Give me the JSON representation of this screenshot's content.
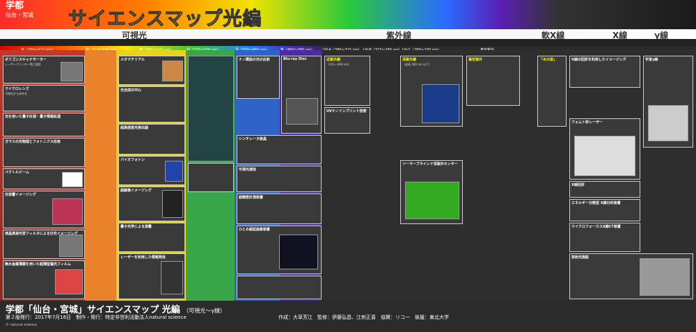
{
  "header": {
    "logo_top": "学都",
    "logo_sub": "仙台・宮城",
    "title": "サイエンスマップ",
    "title_suffix": "光編"
  },
  "bands": [
    "可視光",
    "紫外線",
    "軟X線",
    "X線",
    "γ線"
  ],
  "subbands": [
    "赤（760〜610 nm）",
    "橙（610〜590 nm）",
    "黄（590〜570 nm）",
    "緑（570〜500 nm）",
    "青（500〜460 nm）",
    "紫（460〜380 nm）",
    "UV-A（380〜315 nm）",
    "UV-B（315〜280 nm）",
    "UV-C（280〜100 nm）",
    "真空紫外"
  ],
  "cards": [
    {
      "title": "ポリゴンスキャナモーター",
      "text": "レーザープリンター等に使用"
    },
    {
      "title": "マイクロレンズ",
      "text": "可視光から赤外光"
    },
    {
      "title": "光を用いた量子計測・量子情報処理",
      "text": ""
    },
    {
      "title": "ガラスの光物理とフォトニクス応用",
      "text": ""
    },
    {
      "title": "ペクトルビーム",
      "text": ""
    },
    {
      "title": "光音響イメージング",
      "text": ""
    },
    {
      "title": "液晶高速可変フィルタによる分光イメージング",
      "text": ""
    },
    {
      "title": "無水金属薄膜を用いた超薄型偏光フィルム",
      "text": ""
    },
    {
      "title": "メタマテリアル",
      "text": ""
    },
    {
      "title": "光合成の中心",
      "text": ""
    },
    {
      "title": "超高感度光検出器",
      "text": ""
    },
    {
      "title": "バイオフォトン",
      "text": ""
    },
    {
      "title": "超解像イメージング",
      "text": ""
    },
    {
      "title": "量子光学による測量",
      "text": ""
    },
    {
      "title": "レーザーを利用した情報発信",
      "text": ""
    },
    {
      "title": "ナノ構造の光の反射",
      "text": ""
    },
    {
      "title": "Blu-ray Disc",
      "text": ""
    },
    {
      "title": "シンチレータ結晶",
      "text": ""
    },
    {
      "title": "可視光通信",
      "text": ""
    },
    {
      "title": "超精密計測装置",
      "text": ""
    },
    {
      "title": "ひとみ認証画像装置",
      "text": ""
    },
    {
      "title": "近紫外線",
      "text": "（315〜400 nm）"
    },
    {
      "title": "UVナノインプリント技術",
      "text": ""
    },
    {
      "title": "深紫外線",
      "text": "（波長 280 nm 以下）"
    },
    {
      "title": "ソーラーブラインド深紫外センサー",
      "text": ""
    },
    {
      "title": "真空紫外",
      "text": ""
    },
    {
      "title": "「水の窓」",
      "text": ""
    },
    {
      "title": "X線の回折を利用したイメージング",
      "text": ""
    },
    {
      "title": "フェムト秒レーザー",
      "text": ""
    },
    {
      "title": "X線回折",
      "text": ""
    },
    {
      "title": "エネルギー分散型 X線分析装置",
      "text": ""
    },
    {
      "title": "マイクロフォーカスX線CT装置",
      "text": ""
    },
    {
      "title": "放射光施設",
      "text": ""
    },
    {
      "title": "宇宙γ線",
      "text": ""
    }
  ],
  "footer": {
    "title": "学都「仙台・宮城」サイエンスマップ 光編",
    "title_note": "（可視光〜γ線）",
    "sub": "第２版発行：2017年7月16日　制作・発行：特定非営利活動法人natural science",
    "credits": "作成：大草芳江　監修：伊藤弘昌、江刺正喜　協賛：リコー　後援：東北大学",
    "bottom": "© natural science"
  }
}
